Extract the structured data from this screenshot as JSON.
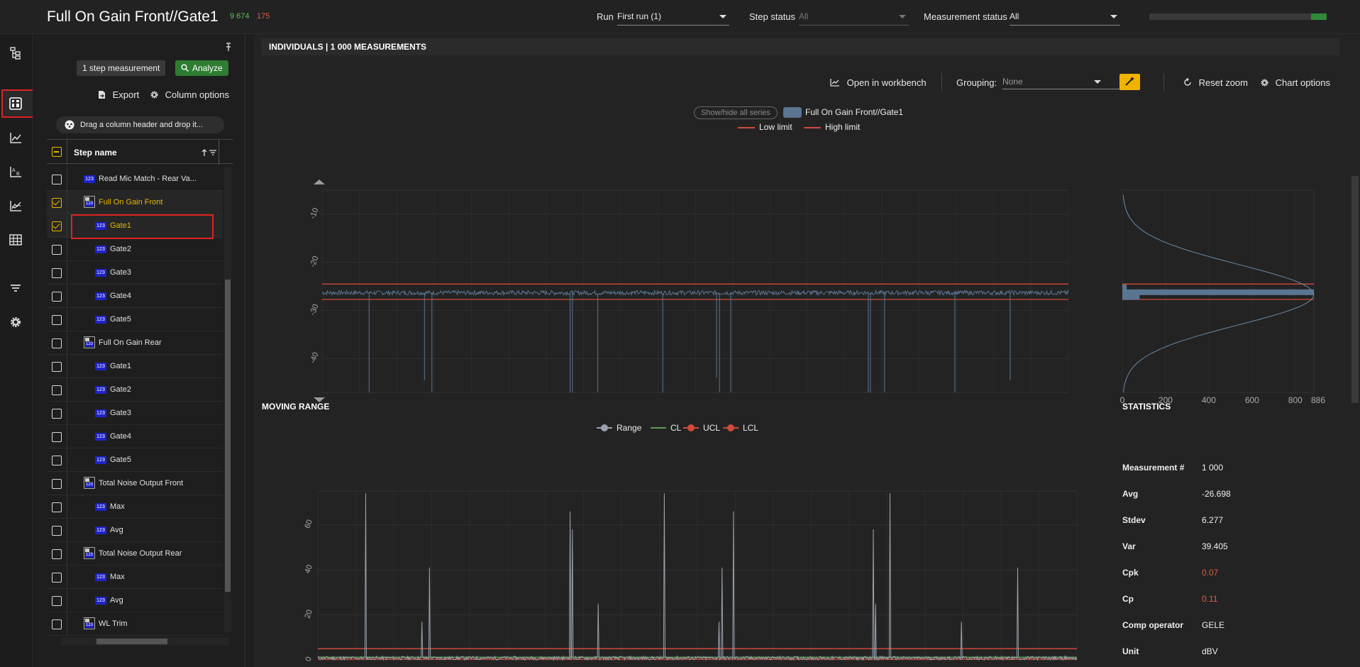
{
  "header": {
    "title": "Full On Gain Front//Gate1",
    "count_pass": "9 674",
    "count_fail": "175",
    "run_label": "Run",
    "run_value": "First run (1)",
    "step_status_label": "Step status",
    "step_status_value": "All",
    "measurement_status_label": "Measurement status",
    "measurement_status_value": "All",
    "progress_pass_fraction": 0.09
  },
  "nav": {
    "items": [
      "hierarchy-icon",
      "dashboard-icon",
      "line-chart-icon",
      "ab-compare-icon",
      "trend-chart-icon",
      "table-icon",
      "filter-icon",
      "settings-icon"
    ],
    "active": "dashboard-icon"
  },
  "steps_panel": {
    "step_measurement_button": "1 step measurement",
    "analyze_button": "Analyze",
    "export_label": "Export",
    "column_options_label": "Column options",
    "drag_hint": "Drag a column header and drop it...",
    "column_header": "Step name",
    "rows": [
      {
        "label": "Read Mic Match - Rear Va...",
        "type": "num",
        "indent": 1,
        "checked": false
      },
      {
        "label": "Full On Gain Front",
        "type": "group",
        "indent": 1,
        "checked": true,
        "highlight": true
      },
      {
        "label": "Gate1",
        "type": "num",
        "indent": 2,
        "checked": true,
        "highlight": true
      },
      {
        "label": "Gate2",
        "type": "num",
        "indent": 2,
        "checked": false
      },
      {
        "label": "Gate3",
        "type": "num",
        "indent": 2,
        "checked": false
      },
      {
        "label": "Gate4",
        "type": "num",
        "indent": 2,
        "checked": false
      },
      {
        "label": "Gate5",
        "type": "num",
        "indent": 2,
        "checked": false
      },
      {
        "label": "Full On Gain Rear",
        "type": "group",
        "indent": 1,
        "checked": false
      },
      {
        "label": "Gate1",
        "type": "num",
        "indent": 2,
        "checked": false
      },
      {
        "label": "Gate2",
        "type": "num",
        "indent": 2,
        "checked": false
      },
      {
        "label": "Gate3",
        "type": "num",
        "indent": 2,
        "checked": false
      },
      {
        "label": "Gate4",
        "type": "num",
        "indent": 2,
        "checked": false
      },
      {
        "label": "Gate5",
        "type": "num",
        "indent": 2,
        "checked": false
      },
      {
        "label": "Total Noise Output Front",
        "type": "group",
        "indent": 1,
        "checked": false
      },
      {
        "label": "Max",
        "type": "num",
        "indent": 2,
        "checked": false
      },
      {
        "label": "Avg",
        "type": "num",
        "indent": 2,
        "checked": false
      },
      {
        "label": "Total Noise Output Rear",
        "type": "group",
        "indent": 1,
        "checked": false
      },
      {
        "label": "Max",
        "type": "num",
        "indent": 2,
        "checked": false
      },
      {
        "label": "Avg",
        "type": "num",
        "indent": 2,
        "checked": false
      },
      {
        "label": "WL Trim",
        "type": "group",
        "indent": 1,
        "checked": false
      }
    ],
    "icon_text": "123"
  },
  "individuals": {
    "title": "INDIVIDUALS | 1 000 MEASUREMENTS",
    "open_workbench": "Open in workbench",
    "grouping_label": "Grouping:",
    "grouping_value": "None",
    "reset_zoom": "Reset zoom",
    "chart_options": "Chart options",
    "show_hide": "Show/hide all series",
    "series_name": "Full On Gain Front//Gate1",
    "low_limit": "Low limit",
    "high_limit": "High limit"
  },
  "moving_range": {
    "title": "MOVING RANGE",
    "legend": [
      "Range",
      "CL",
      "UCL",
      "LCL"
    ]
  },
  "statistics": {
    "title": "STATISTICS",
    "items": [
      {
        "label": "Measurement #",
        "value": "1 000",
        "bad": false
      },
      {
        "label": "Avg",
        "value": "-26.698",
        "bad": false
      },
      {
        "label": "Stdev",
        "value": "6.277",
        "bad": false
      },
      {
        "label": "Var",
        "value": "39.405",
        "bad": false
      },
      {
        "label": "Cpk",
        "value": "0.07",
        "bad": true
      },
      {
        "label": "Cp",
        "value": "0.11",
        "bad": true
      },
      {
        "label": "Comp operator",
        "value": "GELE",
        "bad": false
      },
      {
        "label": "Unit",
        "value": "dBV",
        "bad": false
      }
    ]
  },
  "chart_data": [
    {
      "type": "line",
      "name": "individuals",
      "y_ticks": [
        "-10",
        "-20",
        "-30",
        "-40"
      ],
      "ylim": [
        -5,
        -47
      ],
      "x_count": 1000,
      "baseline": -26.3,
      "low_limit": -27.7,
      "high_limit": -24.5,
      "dips": [
        63,
        137,
        147,
        332,
        335,
        369,
        456,
        528,
        532,
        547,
        731,
        734,
        753,
        847,
        921
      ],
      "dip_values": [
        -47,
        -44.5,
        -47,
        -47,
        -47,
        -47,
        -47,
        -44,
        -47,
        -47,
        -47,
        -47,
        -47,
        -47,
        -44.5
      ],
      "legend": [
        "Full On Gain Front//Gate1",
        "Low limit",
        "High limit"
      ],
      "colors": {
        "series": "#5a7591",
        "limit": "#d04a3a"
      }
    },
    {
      "type": "bar",
      "name": "histogram",
      "x_ticks": [
        "0",
        "200",
        "400",
        "600",
        "800",
        "886"
      ],
      "xlim": [
        0,
        886
      ],
      "bins": [
        {
          "y": -26.2,
          "count": 886
        },
        {
          "y": -27.2,
          "count": 80
        },
        {
          "y": -25.2,
          "count": 20
        }
      ]
    },
    {
      "type": "line",
      "name": "moving_range",
      "y_ticks": [
        "0",
        "20",
        "40",
        "60"
      ],
      "ylim": [
        0,
        75
      ],
      "ucl": 5,
      "cl": 1.2,
      "lcl": 0,
      "spikes": [
        63,
        137,
        147,
        332,
        335,
        369,
        456,
        528,
        532,
        547,
        731,
        734,
        753,
        847,
        921
      ],
      "spike_values": [
        74,
        17,
        41,
        66,
        58,
        25,
        74,
        17,
        41,
        66,
        58,
        25,
        74,
        17,
        41
      ],
      "colors": {
        "range": "#9aa3ad",
        "cl": "#5d9b4d",
        "ucl": "#d04a3a",
        "lcl": "#d04a3a"
      }
    }
  ]
}
